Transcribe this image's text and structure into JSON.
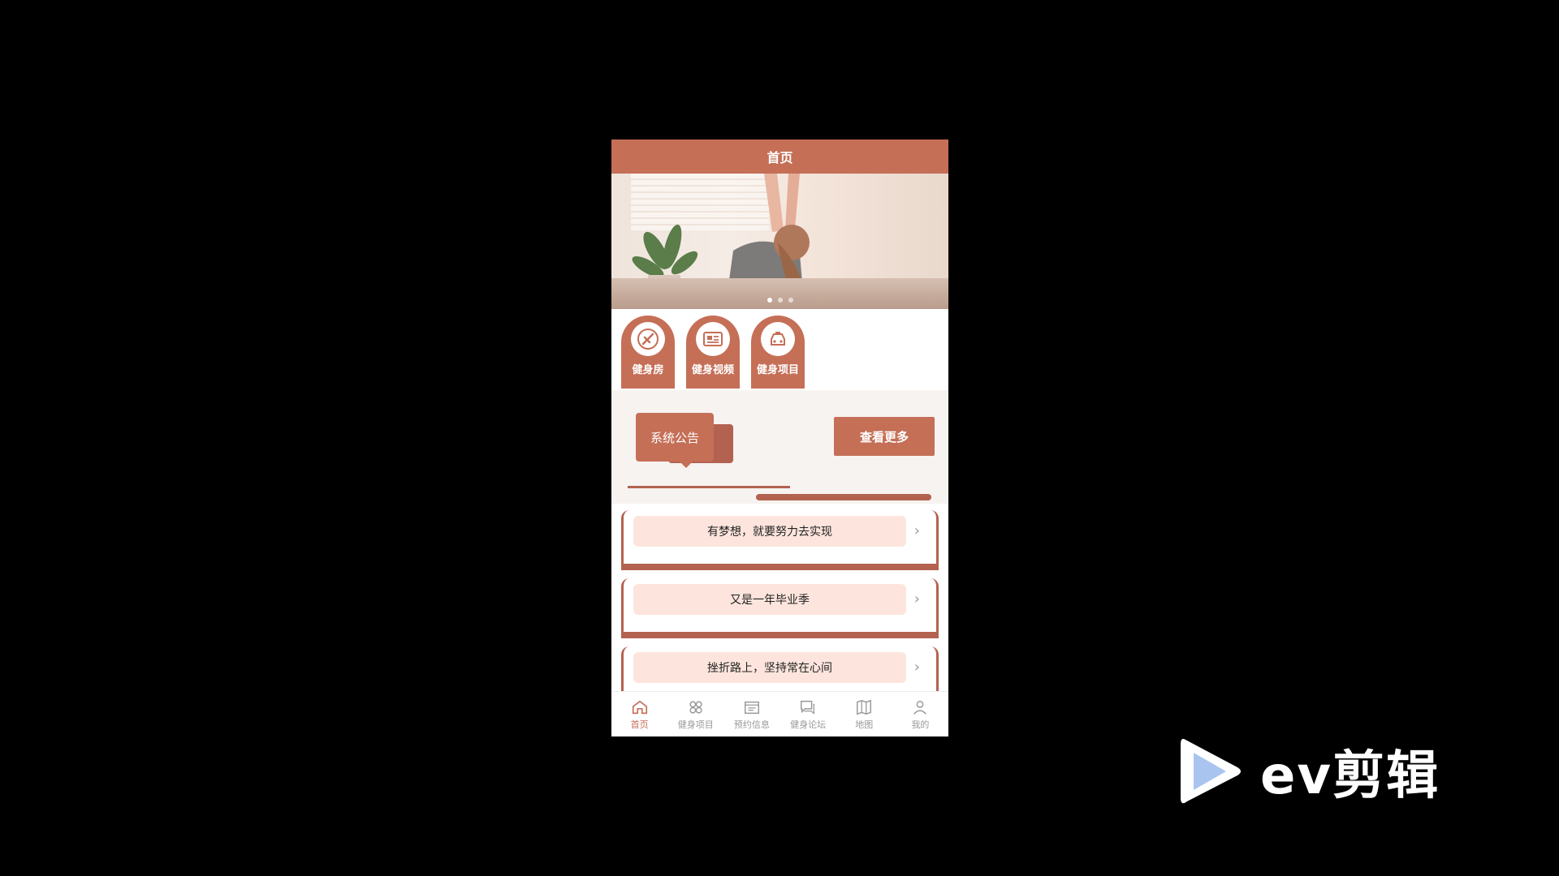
{
  "topbar": {
    "title": "首页"
  },
  "banner": {
    "slides": 3,
    "active_index": 0
  },
  "quick": [
    {
      "label": "健身房",
      "icon": "brush-icon"
    },
    {
      "label": "健身视频",
      "icon": "news-icon"
    },
    {
      "label": "健身项目",
      "icon": "car-icon"
    }
  ],
  "notice": {
    "title": "系统公告",
    "more": "查看更多"
  },
  "list": [
    {
      "text": "有梦想，就要努力去实现"
    },
    {
      "text": "又是一年毕业季"
    },
    {
      "text": "挫折路上，坚持常在心间"
    }
  ],
  "tabbar": [
    {
      "label": "首页",
      "icon": "home-icon",
      "active": true
    },
    {
      "label": "健身项目",
      "icon": "grid-icon",
      "active": false
    },
    {
      "label": "预约信息",
      "icon": "calendar-icon",
      "active": false
    },
    {
      "label": "健身论坛",
      "icon": "chat-icon",
      "active": false
    },
    {
      "label": "地图",
      "icon": "map-icon",
      "active": false
    },
    {
      "label": "我的",
      "icon": "user-icon",
      "active": false
    }
  ],
  "brand": {
    "name": "ev剪辑"
  },
  "colors": {
    "accent": "#c56f57",
    "pill": "#fde5dd"
  }
}
